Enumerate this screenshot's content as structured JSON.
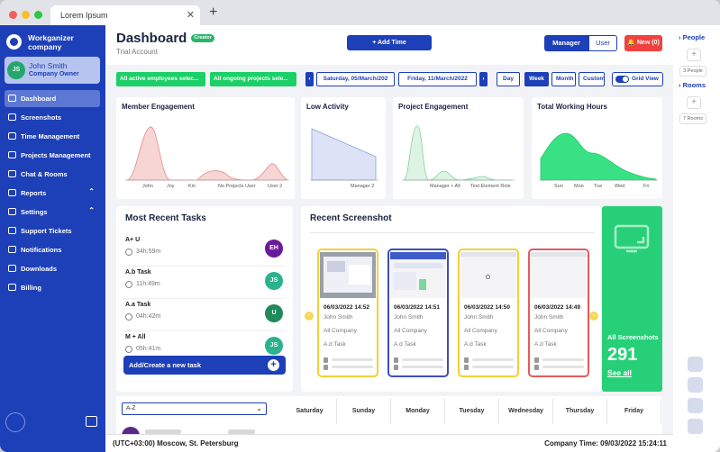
{
  "browser": {
    "tab_title": "Lorem Ipsum",
    "close_glyph": "✕",
    "new_tab_glyph": "+"
  },
  "sidebar": {
    "company": "Workganizer company",
    "user": {
      "initials": "JS",
      "name": "John Smith",
      "role": "Company Owner"
    },
    "items": [
      {
        "label": "Dashboard",
        "icon": "dashboard-icon",
        "active": true
      },
      {
        "label": "Screenshots",
        "icon": "screenshot-icon"
      },
      {
        "label": "Time Management",
        "icon": "calendar-icon"
      },
      {
        "label": "Projects Management",
        "icon": "folder-icon"
      },
      {
        "label": "Chat & Rooms",
        "icon": "chat-icon"
      },
      {
        "label": "Reports",
        "icon": "report-icon",
        "chevron": "⌃"
      },
      {
        "label": "Settings",
        "icon": "gear-icon",
        "chevron": "⌃"
      },
      {
        "label": "Support Tickets",
        "icon": "ticket-icon"
      },
      {
        "label": "Notifications",
        "icon": "bell-icon"
      },
      {
        "label": "Downloads",
        "icon": "download-icon"
      },
      {
        "label": "Billing",
        "icon": "billing-icon"
      }
    ]
  },
  "header": {
    "title": "Dashboard",
    "badge": "Creator",
    "subtitle": "Trial Account",
    "add_time": "+ Add Time",
    "manager": "Manager",
    "user": "User",
    "new_button": "🔔 New (0)"
  },
  "filters": {
    "employees": "All active employees selec...",
    "projects": "All ongoing projects sele...",
    "prev": "‹",
    "next": "›",
    "date_from": "Saturday, 05/March/202",
    "date_to": "Friday, 11/March/2022",
    "day": "Day",
    "week": "Week",
    "month": "Month",
    "custom": "Custom",
    "grid_view": "Grid View"
  },
  "charts": {
    "member_engagement": {
      "title": "Member Engagement",
      "labels": [
        "John",
        "Joy",
        "Kin",
        "No Projects User",
        "User 2"
      ]
    },
    "low_activity": {
      "title": "Low Activity",
      "labels": [
        "Manager 2"
      ]
    },
    "project_engagement": {
      "title": "Project Engagement",
      "labels": [
        "Manager + All",
        "Test Element Role"
      ]
    },
    "total_working_hours": {
      "title": "Total Working Hours",
      "labels": [
        "Sun",
        "Mon",
        "Tue",
        "Wed",
        "Fri"
      ]
    }
  },
  "chart_data": [
    {
      "type": "area",
      "title": "Member Engagement",
      "categories": [
        "John",
        "Joy",
        "Kin",
        "No Projects User",
        "User 2"
      ],
      "values": [
        0.95,
        0.02,
        0.12,
        0.03,
        0.1
      ],
      "color": "#e58b8b"
    },
    {
      "type": "area",
      "title": "Low Activity",
      "categories": [
        "Manager 2"
      ],
      "values": [
        1.0,
        0.0
      ],
      "color": "#8b9be0"
    },
    {
      "type": "area",
      "title": "Project Engagement",
      "categories": [
        "Manager + All",
        "Test Element Role"
      ],
      "values": [
        0.95,
        0.06,
        0.04
      ],
      "color": "#7cd49c"
    },
    {
      "type": "area",
      "title": "Total Working Hours",
      "categories": [
        "Sun",
        "Mon",
        "Tue",
        "Wed",
        "Fri"
      ],
      "values": [
        0.6,
        0.9,
        0.55,
        0.2,
        0.05
      ],
      "color": "#33e07d"
    }
  ],
  "tasks": {
    "title": "Most Recent Tasks",
    "items": [
      {
        "name": "A+ U",
        "time": "34h:59m",
        "initials": "EH",
        "color": "#6a1b9a"
      },
      {
        "name": "A.b Task",
        "time": "11h:49m",
        "initials": "JS",
        "color": "#2bb38e"
      },
      {
        "name": "A.a Task",
        "time": "04h:42m",
        "initials": "U",
        "color": "#1f8a5a"
      },
      {
        "name": "M + All",
        "time": "05h:41m",
        "initials": "JS",
        "color": "#2bb38e"
      }
    ],
    "create": "Add/Create a new task",
    "create_plus": "+"
  },
  "screenshots": {
    "title": "Recent Screenshot",
    "items": [
      {
        "date": "06/03/2022 14:52",
        "user": "John Smith",
        "company": "All Company",
        "task": "A.d Task",
        "border": "#f2cf3a"
      },
      {
        "date": "06/03/2022 14:51",
        "user": "John Smith",
        "company": "All Company",
        "task": "A.d Task",
        "border": "#3f4fb8"
      },
      {
        "date": "06/03/2022 14:50",
        "user": "John Smith",
        "company": "All Company",
        "task": "A.d Task",
        "border": "#f2cf3a"
      },
      {
        "date": "06/03/2022 14:49",
        "user": "John Smith",
        "company": "All Company",
        "task": "A.d Task",
        "border": "#e45b5b"
      }
    ],
    "all_label": "All Screenshots",
    "count": "291",
    "see_all": "See all",
    "left_arrow": "‹",
    "right_arrow": "›"
  },
  "schedule": {
    "sort": "A-Z",
    "days": [
      "Saturday",
      "Sunday",
      "Monday",
      "Tuesday",
      "Wednesday",
      "Thursday",
      "Friday"
    ]
  },
  "rightbar": {
    "people": "› People",
    "people_count": "3 People",
    "rooms": "› Rooms",
    "rooms_count": "7 Rooms",
    "plus": "+"
  },
  "footer": {
    "timezone": "(UTC+03:00) Moscow, St. Petersburg",
    "company_time": "Company Time: 09/03/2022 15:24:11"
  }
}
